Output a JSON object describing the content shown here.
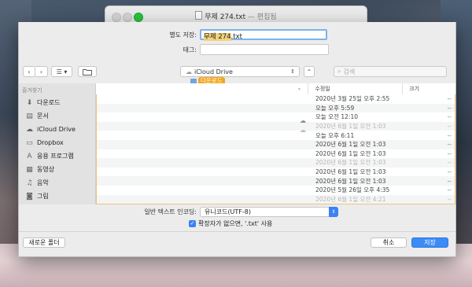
{
  "window": {
    "doc_name": "무제 274.txt",
    "doc_state": "— 편집됨"
  },
  "save_form": {
    "save_as_label": "별도 저장:",
    "filename_base": "무제 274",
    "filename_ext": ".txt",
    "tags_label": "태그:"
  },
  "toolbar": {
    "back_icon": "‹",
    "forward_icon": "›",
    "view_icon": "☰",
    "location": "iCloud Drive",
    "search_placeholder": "검색",
    "drag_badge": "다운로드"
  },
  "sidebar": {
    "heading": "즐겨찾기",
    "items": [
      {
        "label": "다운로드",
        "icon": "download-icon"
      },
      {
        "label": "문서",
        "icon": "document-icon"
      },
      {
        "label": "iCloud Drive",
        "icon": "cloud-icon"
      },
      {
        "label": "Dropbox",
        "icon": "folder-icon"
      },
      {
        "label": "응용 프로그램",
        "icon": "applications-icon"
      },
      {
        "label": "동영상",
        "icon": "movies-icon"
      },
      {
        "label": "음악",
        "icon": "music-icon"
      },
      {
        "label": "그림",
        "icon": "camera-icon"
      }
    ]
  },
  "file_list": {
    "columns": {
      "name": "",
      "date": "수정일",
      "size": "크기"
    },
    "rows": [
      {
        "date": "2020년 3월 25일 오후 2:55",
        "size": "--",
        "cloud": false,
        "dim": false
      },
      {
        "date": "오늘 오후 5:59",
        "size": "--",
        "cloud": false,
        "dim": false
      },
      {
        "date": "오늘 오전 12:10",
        "size": "--",
        "cloud": true,
        "dim": false
      },
      {
        "date": "2020년 6월 1일 오전 1:03",
        "size": "--",
        "cloud": true,
        "dim": true
      },
      {
        "date": "오늘 오후 6:11",
        "size": "--",
        "cloud": false,
        "dim": false
      },
      {
        "date": "2020년 6월 1일 오전 1:03",
        "size": "--",
        "cloud": false,
        "dim": false
      },
      {
        "date": "2020년 6월 1일 오전 1:03",
        "size": "--",
        "cloud": false,
        "dim": false
      },
      {
        "date": "2020년 6월 1일 오전 1:03",
        "size": "--",
        "cloud": false,
        "dim": true
      },
      {
        "date": "2020년 6월 1일 오전 1:03",
        "size": "--",
        "cloud": false,
        "dim": false
      },
      {
        "date": "2020년 6월 1일 오전 1:03",
        "size": "--",
        "cloud": false,
        "dim": false
      },
      {
        "date": "2020년 5월 26일 오후 4:35",
        "size": "--",
        "cloud": false,
        "dim": false
      },
      {
        "date": "2020년 6월 1일 오전 4:21",
        "size": "--",
        "cloud": false,
        "dim": true
      }
    ]
  },
  "encoding": {
    "label": "일반 텍스트 인코딩:",
    "value": "유니코드(UTF-8)"
  },
  "extension_checkbox": {
    "label": "확장자가 없으면, '.txt' 사용",
    "checked": true
  },
  "buttons": {
    "new_folder": "새로운 폴더",
    "cancel": "취소",
    "save": "저장"
  }
}
